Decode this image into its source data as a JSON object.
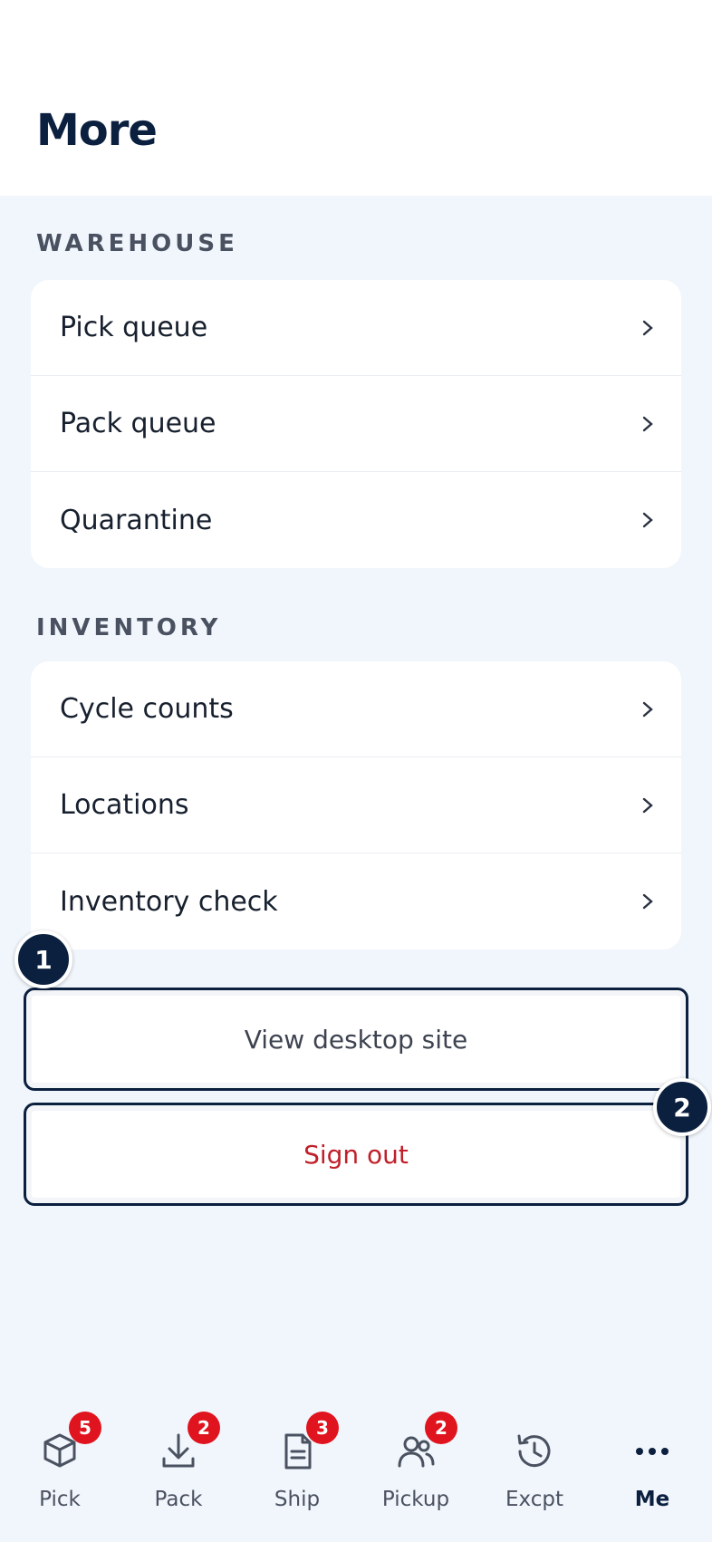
{
  "header": {
    "title": "More"
  },
  "sections": [
    {
      "label": "WAREHOUSE",
      "items": [
        {
          "label": "Pick queue"
        },
        {
          "label": "Pack queue"
        },
        {
          "label": "Quarantine"
        }
      ]
    },
    {
      "label": "INVENTORY",
      "items": [
        {
          "label": "Cycle counts"
        },
        {
          "label": "Locations"
        },
        {
          "label": "Inventory check"
        }
      ]
    }
  ],
  "actions": {
    "view_desktop_label": "View desktop site",
    "sign_out_label": "Sign out"
  },
  "markers": [
    "1",
    "2"
  ],
  "colors": {
    "primary": "#0b1f3f",
    "danger": "#c0202a",
    "badge": "#e0141e",
    "background": "#f1f6fc"
  },
  "nav": {
    "items": [
      {
        "label": "Pick",
        "icon": "box-icon",
        "badge": "5"
      },
      {
        "label": "Pack",
        "icon": "download-icon",
        "badge": "2"
      },
      {
        "label": "Ship",
        "icon": "document-icon",
        "badge": "3"
      },
      {
        "label": "Pickup",
        "icon": "users-icon",
        "badge": "2"
      },
      {
        "label": "Excpt",
        "icon": "history-icon",
        "badge": null
      },
      {
        "label": "Me",
        "icon": "more-dots-icon",
        "badge": null,
        "active": true
      }
    ]
  }
}
